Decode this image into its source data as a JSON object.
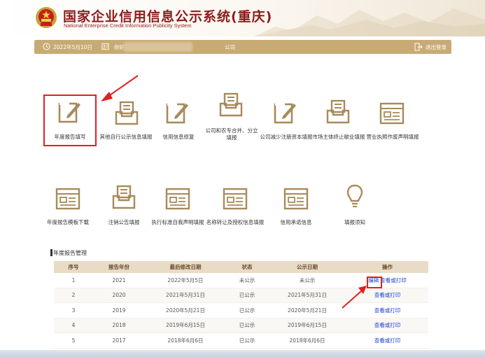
{
  "header": {
    "title": "国家企业信用信息公示系统(重庆)",
    "subtitle": "National Enterprise Credit Information Publicity System"
  },
  "infobar": {
    "date": "2022年5月10日",
    "greeting": "你好!",
    "company_suffix": "公司",
    "logout": "退出登录"
  },
  "tiles_row1": [
    {
      "label": "年度报告填写",
      "icon": "edit-icon"
    },
    {
      "label": "其他自行公示信息填报",
      "icon": "inbox-document-icon"
    },
    {
      "label": "信用信息修复",
      "icon": "edit-icon"
    },
    {
      "label": "公司和农专合并、分立",
      "label2": "填报",
      "icon": "inbox-document-icon"
    },
    {
      "label": "公司减少注册资本填报",
      "icon": "edit-icon"
    },
    {
      "label": "市场主体终止歇业填报",
      "icon": "inbox-document-icon"
    },
    {
      "label": "营业执照作废声明填报",
      "icon": "form-window-icon"
    }
  ],
  "tiles_row2": [
    {
      "label": "年度报告模板下载",
      "icon": "form-window-icon"
    },
    {
      "label": "注销公告填报",
      "icon": "inbox-document-icon"
    },
    {
      "label": "执行标准自我声明填报",
      "icon": "form-window-icon"
    },
    {
      "label": "名称转让及授权信息填报",
      "icon": "form-window-icon"
    },
    {
      "label": "信用承诺信息",
      "icon": "form-window-icon"
    },
    {
      "label": "填报须知",
      "icon": "lightbulb-icon"
    }
  ],
  "section_title": "年度报告管理",
  "table": {
    "headers": [
      "序号",
      "报告年份",
      "最后修改日期",
      "状态",
      "公示日期",
      "操作"
    ],
    "rows": [
      {
        "no": "1",
        "year": "2021",
        "modified": "2022年5月5日",
        "status": "未公示",
        "published": "未公示",
        "ops": [
          "编辑",
          "查看或打印"
        ]
      },
      {
        "no": "2",
        "year": "2020",
        "modified": "2021年5月31日",
        "status": "已公示",
        "published": "2021年5月31日",
        "ops": [
          "查看或打印"
        ]
      },
      {
        "no": "3",
        "year": "2019",
        "modified": "2020年5月21日",
        "status": "已公示",
        "published": "2020年5月21日",
        "ops": [
          "查看或打印"
        ]
      },
      {
        "no": "4",
        "year": "2018",
        "modified": "2019年6月15日",
        "status": "已公示",
        "published": "2019年6月15日",
        "ops": [
          "查看或打印"
        ]
      },
      {
        "no": "5",
        "year": "2017",
        "modified": "2018年6月6日",
        "status": "已公示",
        "published": "2018年6月6日",
        "ops": [
          "查看或打印"
        ]
      }
    ]
  },
  "colors": {
    "brand_red": "#8c1b1b",
    "infobar_gold": "#c8ab74",
    "icon_gold": "#a88a5a",
    "link_blue": "#1a3fd0",
    "highlight_red": "#e02020"
  }
}
